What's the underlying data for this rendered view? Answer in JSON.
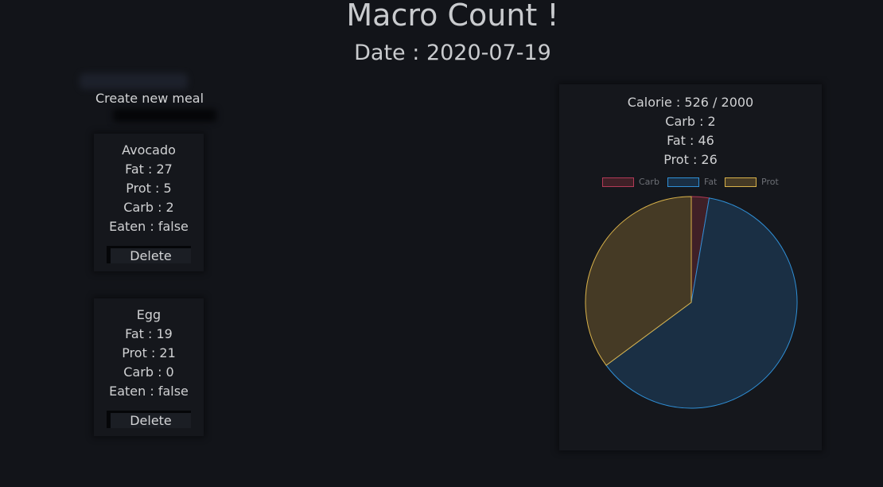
{
  "header": {
    "title": "Macro Count !",
    "date_label": "Date :",
    "date_value": "2020-07-19"
  },
  "create_meal_label": "Create new meal",
  "meals": [
    {
      "name": "Avocado",
      "fat": "Fat : 27",
      "prot": "Prot : 5",
      "carb": "Carb : 2",
      "eaten": "Eaten : false",
      "delete_label": "Delete"
    },
    {
      "name": "Egg",
      "fat": "Fat : 19",
      "prot": "Prot : 21",
      "carb": "Carb : 0",
      "eaten": "Eaten : false",
      "delete_label": "Delete"
    }
  ],
  "summary": {
    "calorie": "Calorie : 526 / 2000",
    "carb": "Carb : 2",
    "fat": "Fat : 46",
    "prot": "Prot : 26"
  },
  "chart_data": {
    "type": "pie",
    "categories": [
      "Carb",
      "Fat",
      "Prot"
    ],
    "values": [
      2,
      46,
      26
    ],
    "legend": "top",
    "colors": {
      "Carb": {
        "border": "#b33a57",
        "fill": "#3f2027"
      },
      "Fat": {
        "border": "#2f8fd6",
        "fill": "#1a2f44"
      },
      "Prot": {
        "border": "#d9b24a",
        "fill": "#453a25"
      }
    }
  }
}
